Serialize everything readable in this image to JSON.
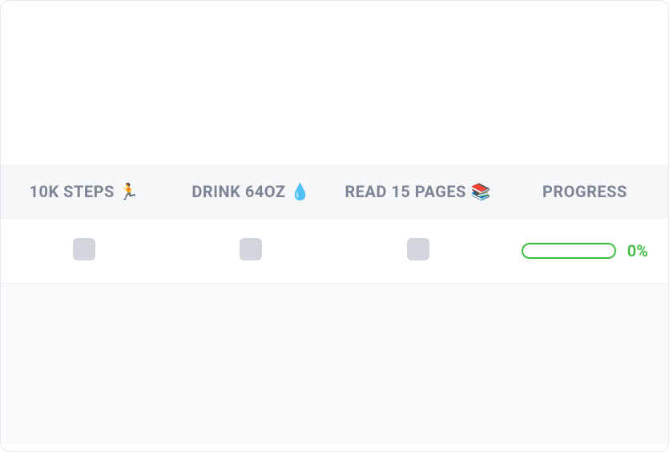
{
  "headers": {
    "steps": "10K STEPS 🏃",
    "water": "DRINK 64OZ 💧",
    "read": "READ 15 PAGES 📚",
    "progress": "PROGRESS"
  },
  "row": {
    "steps_checked": false,
    "water_checked": false,
    "read_checked": false,
    "progress_pct": "0%",
    "progress_value": 0
  },
  "colors": {
    "progress_green": "#3fbf3f"
  }
}
